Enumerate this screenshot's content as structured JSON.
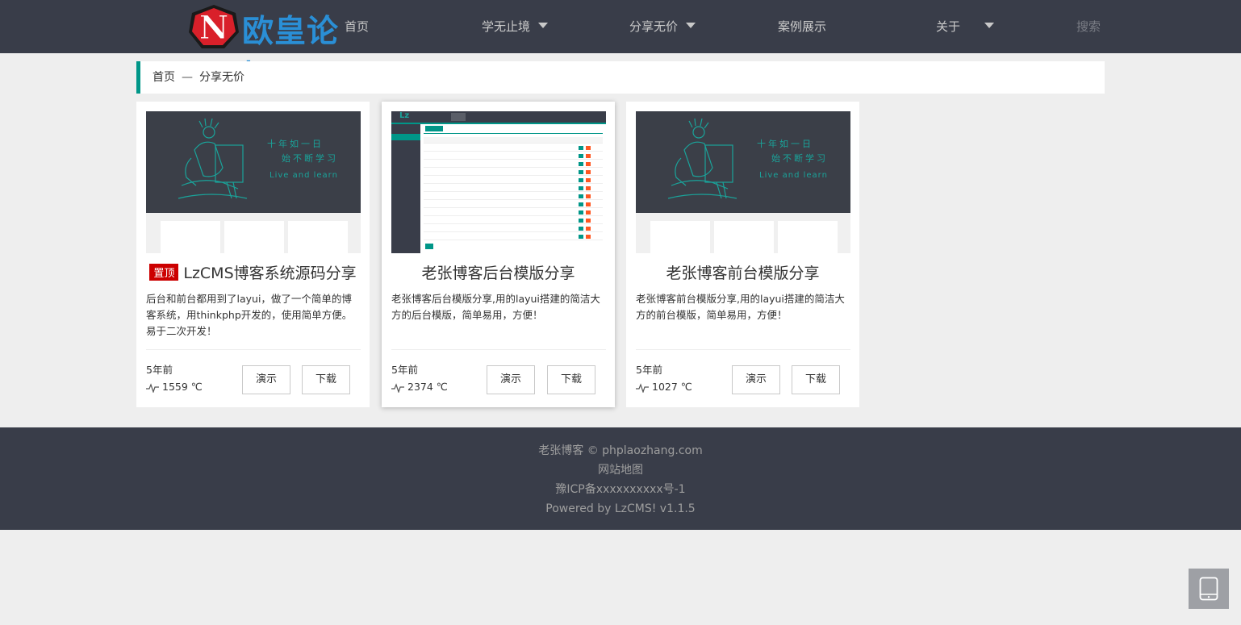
{
  "header": {
    "logo_text": "欧皇论坛",
    "nav": [
      {
        "label": "首页",
        "has_dropdown": false
      },
      {
        "label": "学无止境",
        "has_dropdown": true
      },
      {
        "label": "分享无价",
        "has_dropdown": true
      },
      {
        "label": "案例展示",
        "has_dropdown": false
      },
      {
        "label": "关于",
        "has_dropdown": true
      }
    ],
    "search_label": "搜索"
  },
  "breadcrumb": {
    "home": "首页",
    "separator": "—",
    "current": "分享无价"
  },
  "cards": [
    {
      "badge": "置顶",
      "title": "LzCMS博客系统源码分享",
      "desc": "后台和前台都用到了layui，做了一个简单的博客系统，用thinkphp开发的，使用简单方便。易于二次开发！",
      "date": "5年前",
      "views": "1559 ℃",
      "demo_label": "演示",
      "download_label": "下载",
      "thumb_text": [
        "十年如一日",
        "始不断学习",
        "Live and learn"
      ]
    },
    {
      "badge": "",
      "title": "老张博客后台模版分享",
      "desc": "老张博客后台模版分享,用的layui搭建的简洁大方的后台模版，简单易用，方便！",
      "date": "5年前",
      "views": "2374 ℃",
      "demo_label": "演示",
      "download_label": "下载",
      "thumb_text": [
        "Lz"
      ]
    },
    {
      "badge": "",
      "title": "老张博客前台模版分享",
      "desc": "老张博客前台模版分享,用的layui搭建的简洁大方的前台模版，简单易用，方便！",
      "date": "5年前",
      "views": "1027 ℃",
      "demo_label": "演示",
      "download_label": "下载",
      "thumb_text": [
        "十年如一日",
        "始不断学习",
        "Live and learn"
      ]
    }
  ],
  "footer": {
    "copyright": "老张博客 ©  phplaozhang.com",
    "sitemap": "网站地图",
    "icp": "豫ICP备xxxxxxxxxx号-1",
    "powered": "Powered by LzCMS! v1.1.5"
  },
  "colors": {
    "header_bg": "#393d49",
    "accent": "#009688",
    "badge": "#cc0000",
    "logo_blue": "#2a8fd6",
    "logo_red": "#e0202a"
  },
  "icons": {
    "views": "pulse-icon",
    "float": "tablet-icon"
  }
}
